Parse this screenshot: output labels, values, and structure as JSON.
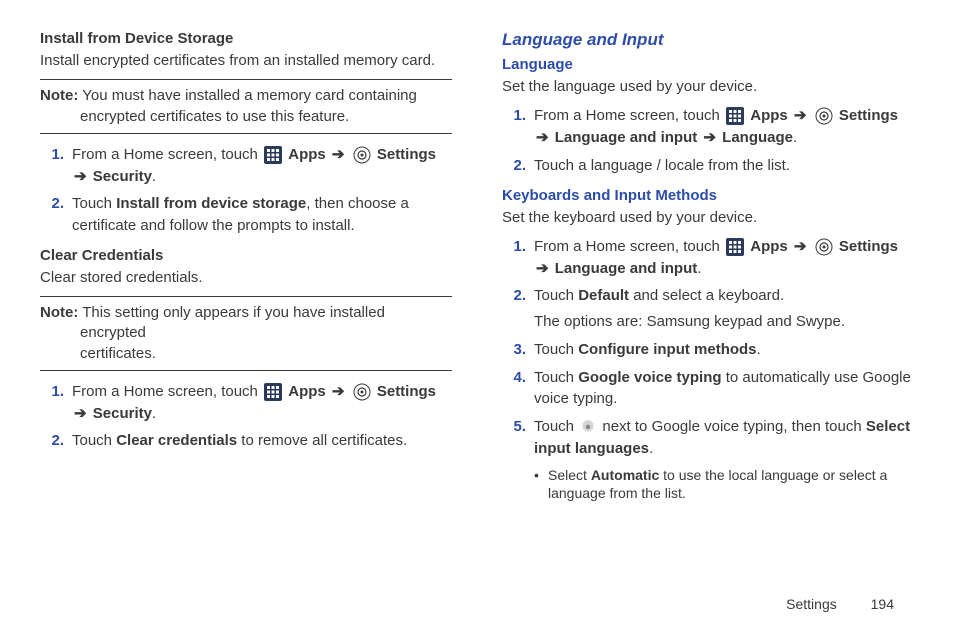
{
  "left": {
    "install_heading": "Install from Device Storage",
    "install_body": "Install encrypted certificates from an installed memory card.",
    "note1_label": "Note:",
    "note1_line1": "You must have installed a memory card containing",
    "note1_line2": "encrypted certificates to use this feature.",
    "step1_prefix": "From a Home screen, touch ",
    "apps": "Apps",
    "arrow": "➔",
    "settings": "Settings",
    "security": "Security",
    "step2_prefix": "Touch ",
    "step2_bold": "Install from device storage",
    "step2_suffix": ", then choose a certificate and follow the prompts to install.",
    "clear_heading": "Clear Credentials",
    "clear_body": "Clear stored credentials.",
    "note2_label": "Note:",
    "note2_line1": "This setting only appears if you have installed encrypted",
    "note2_line2": "certificates.",
    "step_c2_bold": "Clear credentials",
    "step_c2_suffix": " to remove all certificates."
  },
  "right": {
    "lang_input_heading": "Language and Input",
    "language_heading": "Language",
    "language_body": "Set the language used by your device.",
    "step1_prefix": "From a Home screen, touch ",
    "apps": "Apps",
    "arrow": "➔",
    "settings": "Settings",
    "lang_input_bold": "Language and input",
    "language_bold": "Language",
    "step2_lang": "Touch a language / locale from the list.",
    "keyboards_heading": "Keyboards and Input Methods",
    "keyboards_body": "Set the keyboard used by your device.",
    "step2_kbd_prefix": "Touch ",
    "default_bold": "Default",
    "step2_kbd_suffix": " and select a keyboard.",
    "step2_kbd_line2": "The options are: Samsung keypad and Swype.",
    "step3_bold": "Configure input methods",
    "step4_prefix": "Touch ",
    "step4_bold": "Google voice typing",
    "step4_suffix": " to automatically use Google voice typing.",
    "step5_prefix": "Touch ",
    "step5_mid": " next to Google voice typing, then touch ",
    "step5_bold": "Select input languages",
    "sub_prefix": "Select ",
    "sub_bold": "Automatic",
    "sub_suffix": " to use the local language or select a language from the list."
  },
  "nums": {
    "n1": "1.",
    "n2": "2.",
    "n3": "3.",
    "n4": "4.",
    "n5": "5."
  },
  "footer": {
    "section": "Settings",
    "page": "194"
  }
}
